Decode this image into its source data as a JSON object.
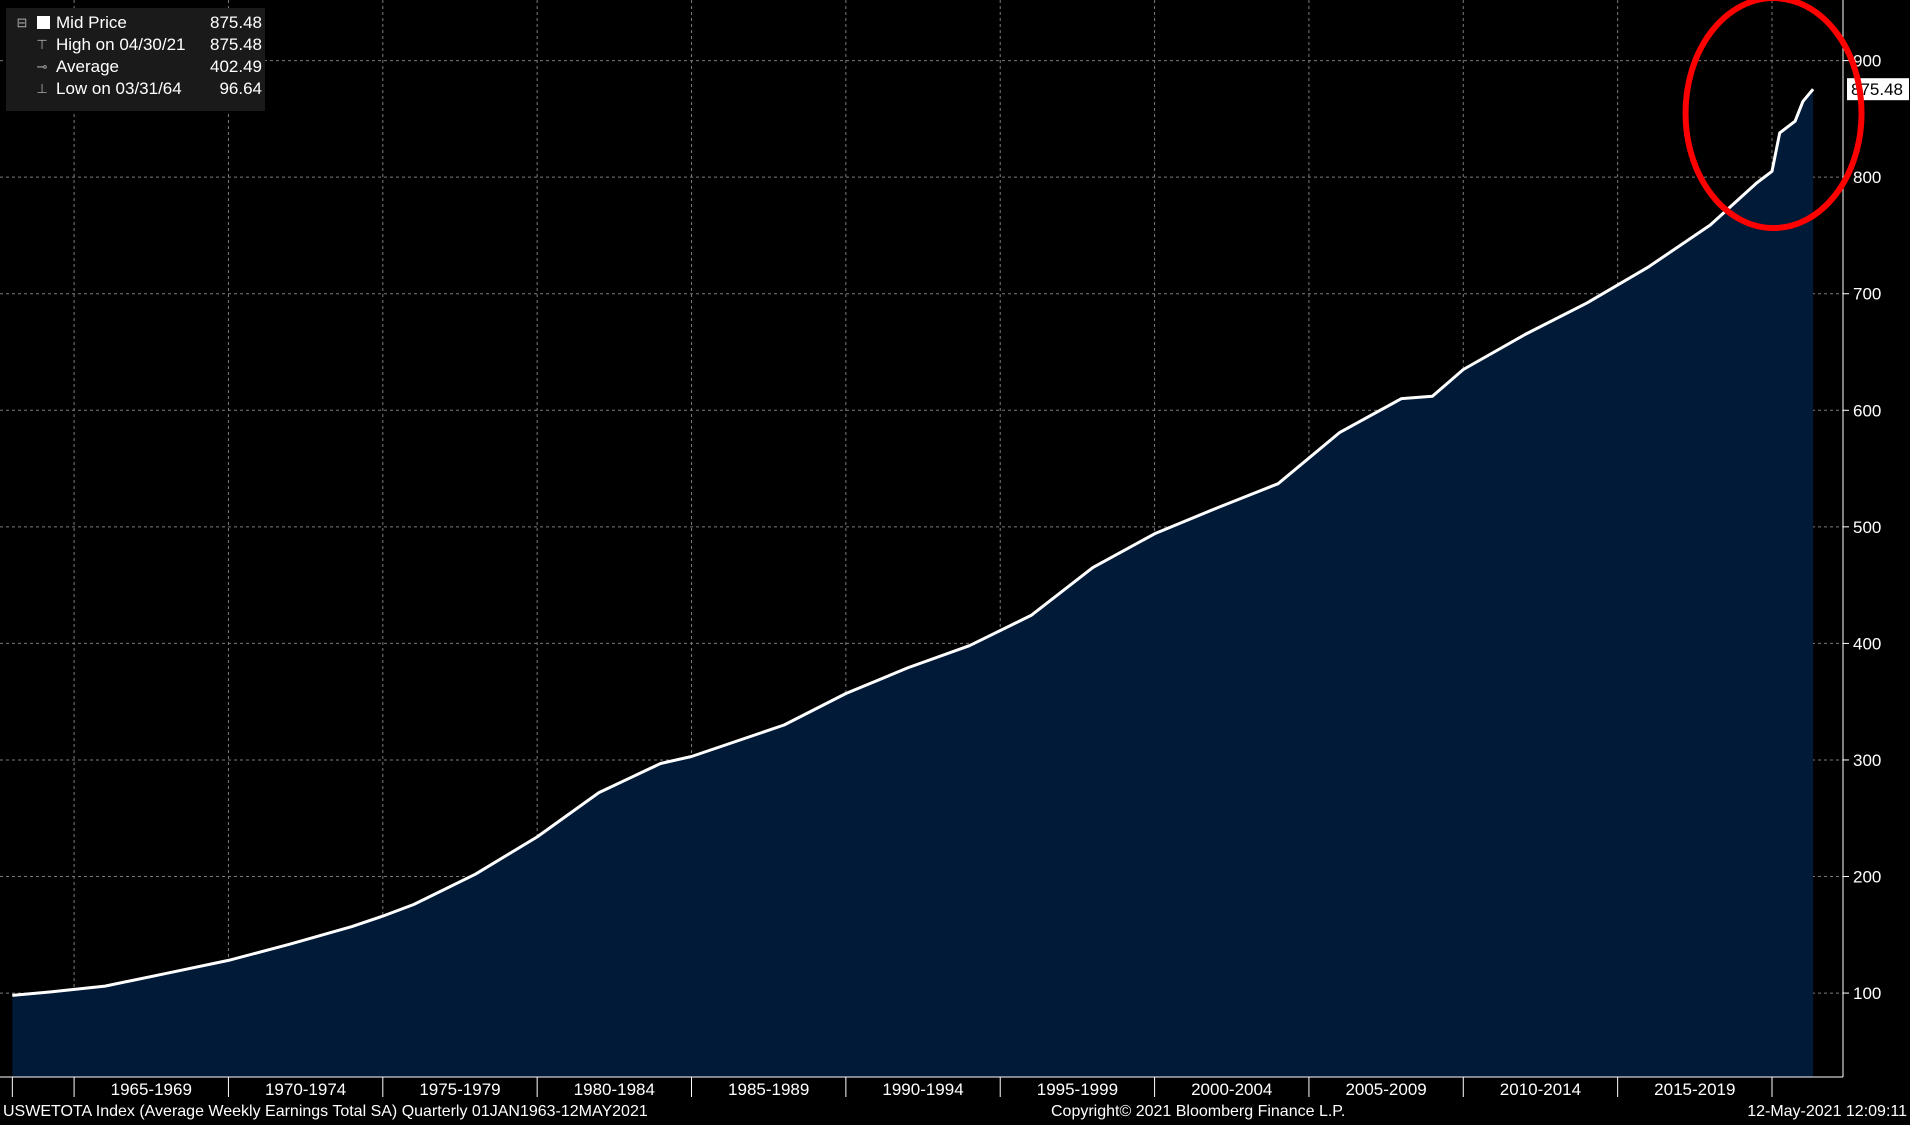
{
  "legend": {
    "series_label": "Mid Price",
    "series_value": "875.48",
    "high_label": "High on 04/30/21",
    "high_value": "875.48",
    "avg_label": "Average",
    "avg_value": "402.49",
    "low_label": "Low on 03/31/64",
    "low_value": "96.64"
  },
  "footer": {
    "left": "USWETOTA Index (Average Weekly Earnings Total SA)  Quarterly 01JAN1963-12MAY2021",
    "center": "Copyright© 2021 Bloomberg Finance L.P.",
    "right": "12-May-2021 12:09:11"
  },
  "colors": {
    "background": "#000000",
    "area_fill": "#011a37",
    "line": "#ffffff",
    "grid": "#7a7a7a",
    "annotation": "#ff0000",
    "legend_bg": "#1a1a1a"
  },
  "chart_data": {
    "type": "area",
    "x": [
      1963.0,
      1964.25,
      1966.0,
      1968.0,
      1970.0,
      1972.0,
      1974.0,
      1975.0,
      1976.0,
      1978.0,
      1980.0,
      1982.0,
      1984.0,
      1985.0,
      1986.0,
      1988.0,
      1990.0,
      1992.0,
      1994.0,
      1996.0,
      1998.0,
      2000.0,
      2002.0,
      2004.0,
      2006.0,
      2008.0,
      2009.0,
      2010.0,
      2012.0,
      2014.0,
      2016.0,
      2018.0,
      2019.5,
      2020.0,
      2020.25,
      2020.75,
      2021.0,
      2021.33
    ],
    "y": [
      98,
      101,
      106,
      117,
      128,
      142,
      157,
      166,
      176,
      202,
      234,
      272,
      297,
      303,
      312,
      330,
      357,
      379,
      398,
      424,
      465,
      494,
      516,
      537,
      581,
      610,
      612,
      635,
      665,
      692,
      723,
      759,
      795,
      805,
      838,
      848,
      865,
      875.48
    ],
    "y_ticks": [
      100,
      200,
      300,
      400,
      500,
      600,
      700,
      800,
      900
    ],
    "ylim": [
      28,
      952
    ],
    "xlim": [
      1962.6,
      2022.3
    ],
    "x_period_labels": [
      "1965-1969",
      "1970-1974",
      "1975-1979",
      "1980-1984",
      "1985-1989",
      "1990-1994",
      "1995-1999",
      "2000-2004",
      "2005-2009",
      "2010-2014",
      "2015-2019"
    ],
    "x_period_starts": [
      1965,
      1970,
      1975,
      1980,
      1985,
      1990,
      1995,
      2000,
      2005,
      2010,
      2015
    ],
    "last_value_label": "875.48",
    "grid": true,
    "y_axis_side": "right",
    "annotation": "red ellipse highlighting 2019-2021"
  }
}
